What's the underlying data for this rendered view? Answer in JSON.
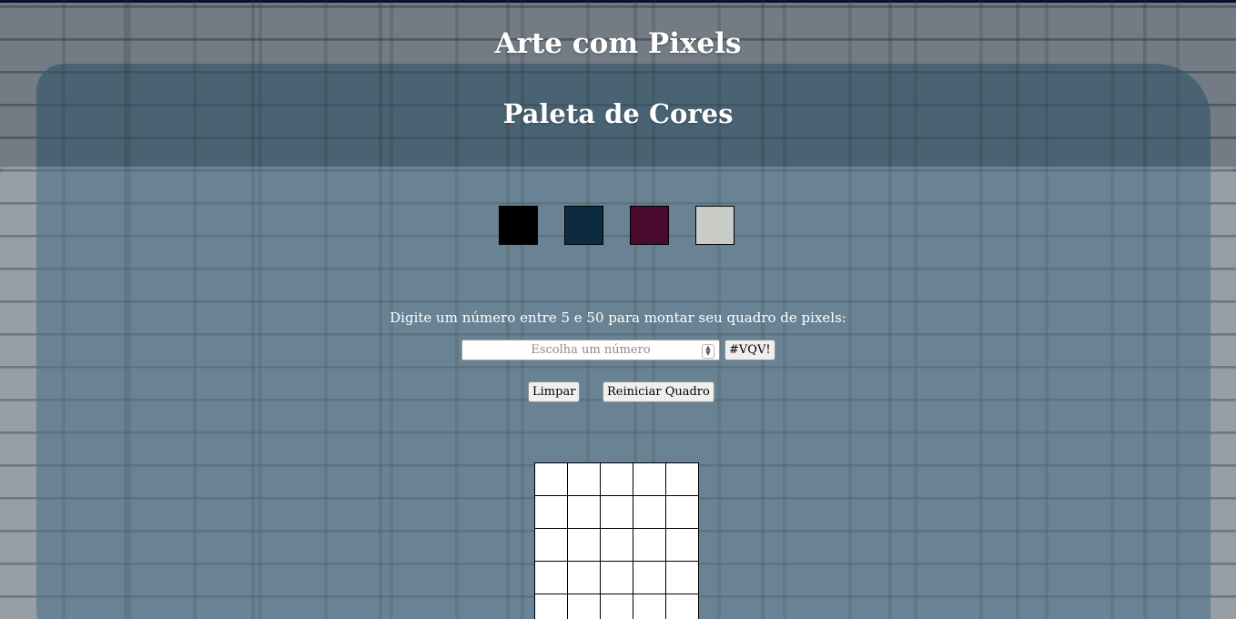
{
  "header": {
    "title": "Arte com Pixels",
    "subtitle": "Paleta de Cores"
  },
  "palette": {
    "colors": [
      "#000000",
      "#0e2a40",
      "#4a0a30",
      "#c8cbc6"
    ]
  },
  "board_form": {
    "instructions": "Digite um número entre 5 e 50 para montar seu quadro de pixels:",
    "input_placeholder": "Escolha um número",
    "generate_label": "#VQV!"
  },
  "actions": {
    "clear_label": "Limpar",
    "reset_label": "Reiniciar Quadro"
  },
  "board": {
    "columns": 5,
    "pixel_color": "#ffffff"
  },
  "theme": {
    "title_color": "#ffffff",
    "border_color": "#0b0f35"
  }
}
